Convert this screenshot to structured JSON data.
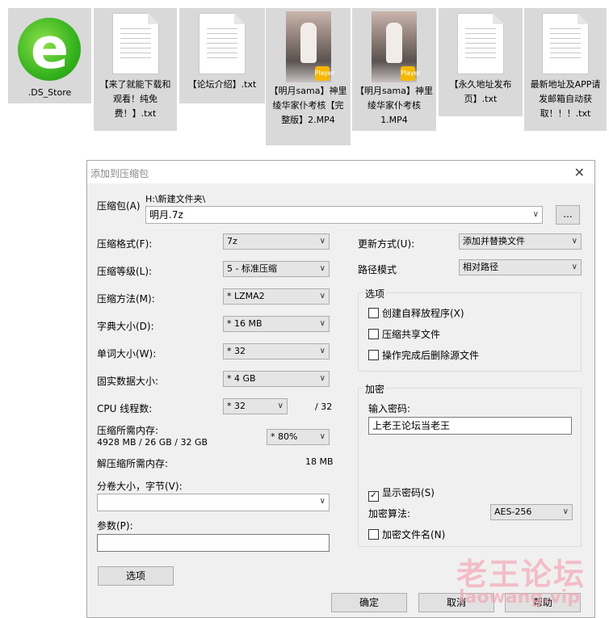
{
  "desktop": {
    "files": [
      {
        "name": ".DS_Store",
        "kind": "ie"
      },
      {
        "name": "【来了就能下载和观看！纯免费！】.txt",
        "kind": "txt"
      },
      {
        "name": "【论坛介绍】.txt",
        "kind": "txt"
      },
      {
        "name": "【明月sama】神里绫华家仆考核【完整版】2.MP4",
        "kind": "video"
      },
      {
        "name": "【明月sama】神里绫华家仆考核1.MP4",
        "kind": "video"
      },
      {
        "name": "【永久地址发布页】.txt",
        "kind": "txt"
      },
      {
        "name": "最新地址及APP请发邮箱自动获取！！！.txt",
        "kind": "txt"
      }
    ],
    "badge_text": "Player"
  },
  "dialog": {
    "title": "添加到压缩包",
    "archive_label": "压缩包(A)",
    "archive_path": "H:\\新建文件夹\\",
    "archive_name": "明月.7z",
    "browse_label": "...",
    "format_label": "压缩格式(F):",
    "format_value": "7z",
    "level_label": "压缩等级(L):",
    "level_value": "5 - 标准压缩",
    "method_label": "压缩方法(M):",
    "method_value": "* LZMA2",
    "dict_label": "字典大小(D):",
    "dict_value": "* 16 MB",
    "word_label": "单词大小(W):",
    "word_value": "* 32",
    "solid_label": "固实数据大小:",
    "solid_value": "* 4 GB",
    "cpu_label": "CPU 线程数:",
    "cpu_value": "* 32",
    "cpu_max": "/ 32",
    "mem_label": "压缩所需内存:",
    "mem_value": "4928 MB / 26 GB / 32 GB",
    "mem_pct": "* 80%",
    "decomp_label": "解压缩所需内存:",
    "decomp_value": "18 MB",
    "split_label": "分卷大小，字节(V):",
    "split_value": "",
    "params_label": "参数(P):",
    "params_value": "",
    "options_button": "选项",
    "update_label": "更新方式(U):",
    "update_value": "添加并替换文件",
    "path_label": "路径模式",
    "path_value": "相对路径",
    "options_group": "选项",
    "opt_sfx": "创建自释放程序(X)",
    "opt_shared": "压缩共享文件",
    "opt_delete": "操作完成后删除源文件",
    "encrypt_group": "加密",
    "password_label": "输入密码:",
    "password_value": "上老王论坛当老王",
    "show_password": "显示密码(S)",
    "enc_method_label": "加密算法:",
    "enc_method_value": "AES-256",
    "enc_names": "加密文件名(N)",
    "ok": "确定",
    "cancel": "取消",
    "help": "帮助"
  },
  "watermark": {
    "text": "老王论坛",
    "url": "laowang.vip"
  }
}
